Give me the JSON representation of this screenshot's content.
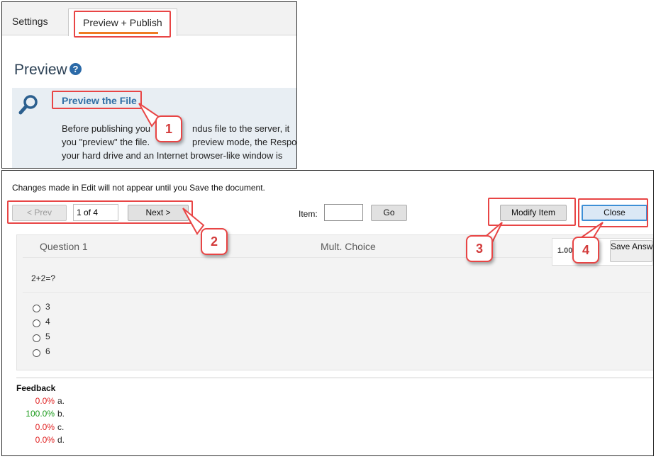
{
  "top": {
    "tabs": [
      {
        "label": "Settings"
      },
      {
        "label": "Preview + Publish"
      }
    ],
    "heading": "Preview",
    "help_icon": "question-circle-icon",
    "search_icon": "magnifier-icon",
    "link": "Preview the File",
    "description_lines": [
      "Before publishing you",
      "you \"preview\" the file.",
      "your hard drive and an Internet browser-like window is"
    ],
    "description_fragments": [
      "ndus file to the server, it",
      "preview mode, the Respo"
    ]
  },
  "bottom": {
    "notice": "Changes made in Edit will not appear until you Save the document.",
    "prev_label": "< Prev",
    "page": "1 of 4",
    "next_label": "Next  >",
    "item_label": "Item:",
    "item_value": "",
    "go_label": "Go",
    "modify_label": "Modify Item",
    "close_label": "Close",
    "question": {
      "title": "Question 1",
      "type": "Mult. Choice",
      "text": "2+2=?",
      "choices": [
        "3",
        "4",
        "5",
        "6"
      ]
    },
    "score": "1.00",
    "save_answer_label": "Save Answer",
    "feedback": {
      "heading": "Feedback",
      "rows": [
        {
          "pct": "0.0%",
          "letter": "a.",
          "color": "#e02020"
        },
        {
          "pct": "100.0%",
          "letter": "b.",
          "color": "#1a9a1a"
        },
        {
          "pct": "0.0%",
          "letter": "c.",
          "color": "#e02020"
        },
        {
          "pct": "0.0%",
          "letter": "d.",
          "color": "#e02020"
        }
      ]
    }
  },
  "annotations": {
    "callouts": [
      "1",
      "2",
      "3",
      "4"
    ],
    "color": "#e84545"
  }
}
